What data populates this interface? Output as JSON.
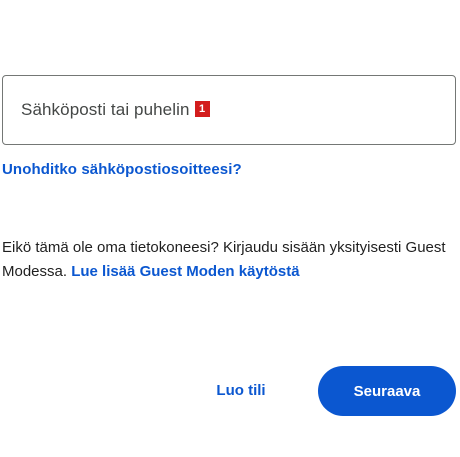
{
  "email_field": {
    "placeholder": "Sähköposti tai puhelin",
    "marker": "1"
  },
  "forgot_email_link": "Unohditko sähköpostiosoitteesi?",
  "guest_mode": {
    "text": "Eikö tämä ole oma tietokoneesi? Kirjaudu sisään yksityisesti Guest Modessa. ",
    "link": "Lue lisää Guest Moden käytöstä"
  },
  "actions": {
    "create_account_label": "Luo tili",
    "next_label": "Seuraava"
  },
  "colors": {
    "accent": "#0b57d0",
    "marker": "#d31c1c",
    "border": "#747775"
  }
}
